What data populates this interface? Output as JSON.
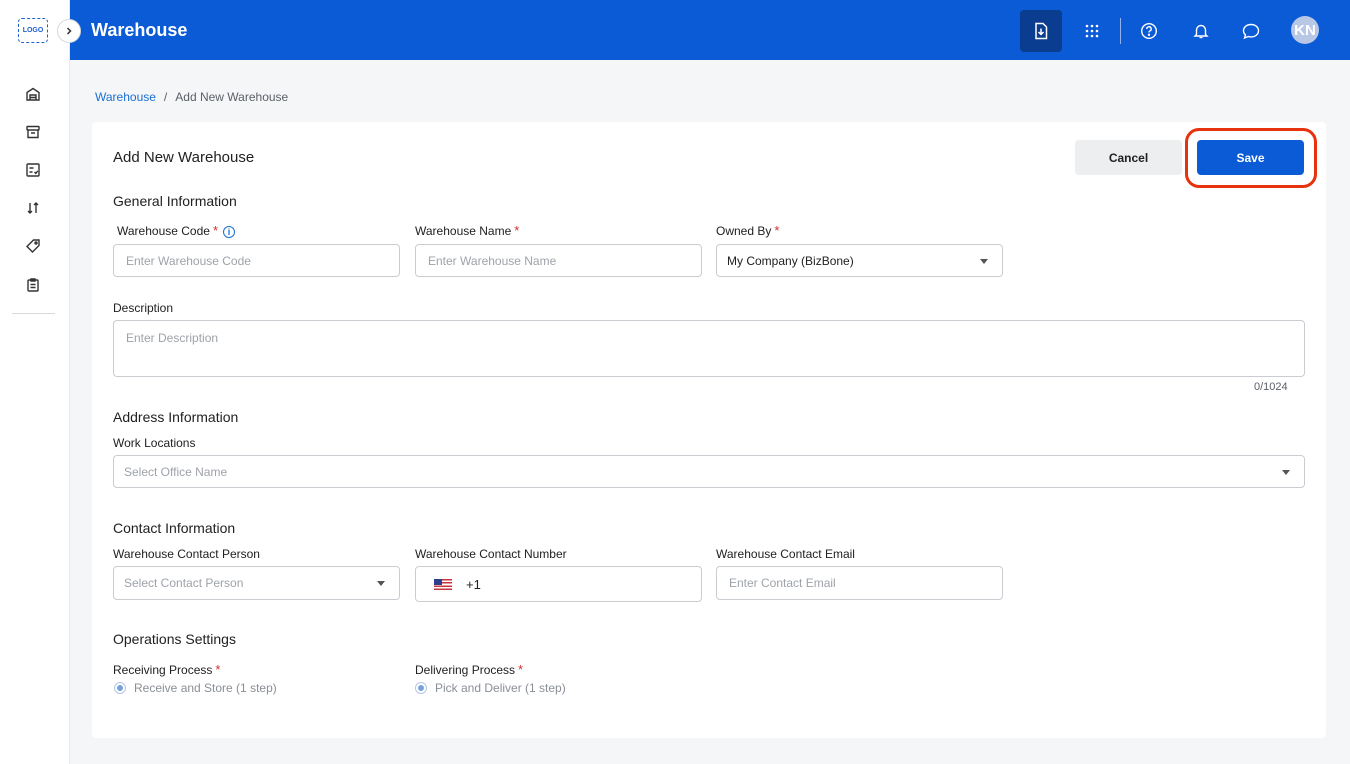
{
  "sidebar": {
    "logo_text": "LOGO",
    "items": [
      {
        "icon": "warehouse-icon"
      },
      {
        "icon": "archive-box-icon"
      },
      {
        "icon": "checklist-icon"
      },
      {
        "icon": "sort-arrows-icon"
      },
      {
        "icon": "tag-icon"
      },
      {
        "icon": "clipboard-icon"
      }
    ]
  },
  "header": {
    "title": "Warehouse",
    "avatar_initials": "KN",
    "icons": [
      "import-document-icon",
      "apps-grid-icon",
      "help-icon",
      "bell-icon",
      "chat-icon"
    ]
  },
  "breadcrumb": {
    "root": "Warehouse",
    "separator": "/",
    "current": "Add New Warehouse"
  },
  "form": {
    "title": "Add New Warehouse",
    "cancel_label": "Cancel",
    "save_label": "Save",
    "general": {
      "title": "General Information",
      "code_label": "Warehouse Code",
      "code_placeholder": "Enter Warehouse Code",
      "name_label": "Warehouse Name",
      "name_placeholder": "Enter Warehouse Name",
      "owned_label": "Owned By",
      "owned_value": "My Company (BizBone)",
      "description_label": "Description",
      "description_placeholder": "Enter Description",
      "description_counter": "0/1024",
      "required_mark": "*"
    },
    "address": {
      "title": "Address Information",
      "locations_label": "Work Locations",
      "locations_placeholder": "Select Office Name"
    },
    "contact": {
      "title": "Contact Information",
      "person_label": "Warehouse Contact Person",
      "person_placeholder": "Select Contact Person",
      "number_label": "Warehouse Contact Number",
      "dial_code": "+1",
      "email_label": "Warehouse Contact Email",
      "email_placeholder": "Enter Contact Email"
    },
    "operations": {
      "title": "Operations Settings",
      "receiving_label": "Receiving Process",
      "receiving_option": "Receive and Store (1 step)",
      "delivering_label": "Delivering Process",
      "delivering_option": "Pick and Deliver (1 step)"
    }
  }
}
